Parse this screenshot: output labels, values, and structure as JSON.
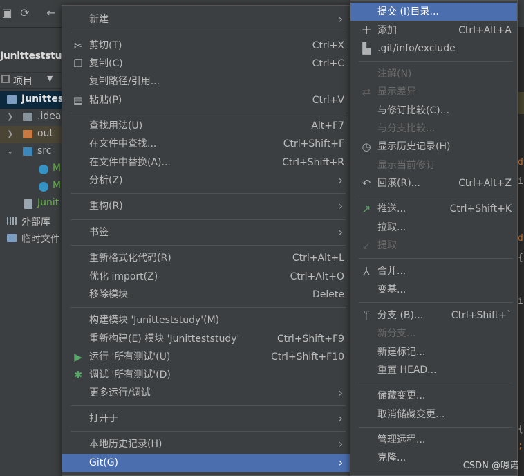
{
  "project_panel": {
    "root_name": "Junitteststudy",
    "view_label": "项目",
    "tree": [
      {
        "label": "Junittes"
      },
      {
        "label": ".idea"
      },
      {
        "label": "out"
      },
      {
        "label": "src"
      },
      {
        "label": "M"
      },
      {
        "label": "M"
      },
      {
        "label": "Junit"
      },
      {
        "label": "外部库"
      },
      {
        "label": "临时文件"
      }
    ]
  },
  "context_menu": {
    "items": [
      {
        "label": "新建",
        "shortcut": "",
        "submenu": true
      },
      {
        "label": "剪切(T)",
        "shortcut": "Ctrl+X",
        "icon": "scissors-icon"
      },
      {
        "label": "复制(C)",
        "shortcut": "Ctrl+C",
        "icon": "copy-icon"
      },
      {
        "label": "复制路径/引用...",
        "shortcut": ""
      },
      {
        "label": "粘贴(P)",
        "shortcut": "Ctrl+V",
        "icon": "paste-icon"
      },
      {
        "label": "查找用法(U)",
        "shortcut": "Alt+F7"
      },
      {
        "label": "在文件中查找...",
        "shortcut": "Ctrl+Shift+F"
      },
      {
        "label": "在文件中替换(A)...",
        "shortcut": "Ctrl+Shift+R"
      },
      {
        "label": "分析(Z)",
        "shortcut": "",
        "submenu": true
      },
      {
        "label": "重构(R)",
        "shortcut": "",
        "submenu": true
      },
      {
        "label": "书签",
        "shortcut": "",
        "submenu": true
      },
      {
        "label": "重新格式化代码(R)",
        "shortcut": "Ctrl+Alt+L"
      },
      {
        "label": "优化 import(Z)",
        "shortcut": "Ctrl+Alt+O"
      },
      {
        "label": "移除模块",
        "shortcut": "Delete"
      },
      {
        "label": "构建模块 'Junitteststudy'(M)",
        "shortcut": ""
      },
      {
        "label": "重新构建(E) 模块 'Junitteststudy'",
        "shortcut": "Ctrl+Shift+F9"
      },
      {
        "label": "运行 '所有测试'(U)",
        "shortcut": "Ctrl+Shift+F10",
        "icon": "run-icon"
      },
      {
        "label": "调试 '所有测试'(D)",
        "shortcut": "",
        "icon": "debug-icon"
      },
      {
        "label": "更多运行/调试",
        "shortcut": "",
        "submenu": true
      },
      {
        "label": "打开于",
        "shortcut": "",
        "submenu": true
      },
      {
        "label": "本地历史记录(H)",
        "shortcut": "",
        "submenu": true
      },
      {
        "label": "Git(G)",
        "shortcut": "",
        "submenu": true,
        "active": true
      }
    ]
  },
  "git_submenu": {
    "items": [
      {
        "label": "提交 (I)目录...",
        "shortcut": "",
        "active": true
      },
      {
        "label": "添加",
        "shortcut": "Ctrl+Alt+A",
        "icon": "plus-icon"
      },
      {
        "label": ".git/info/exclude",
        "shortcut": "",
        "icon": "git-file-icon"
      },
      {
        "label": "注解(N)",
        "shortcut": "",
        "disabled": true
      },
      {
        "label": "显示差异",
        "shortcut": "",
        "disabled": true,
        "icon": "diff-icon"
      },
      {
        "label": "与修订比较(C)...",
        "shortcut": ""
      },
      {
        "label": "与分支比较...",
        "shortcut": "",
        "disabled": true
      },
      {
        "label": "显示历史记录(H)",
        "shortcut": "",
        "icon": "history-icon"
      },
      {
        "label": "显示当前修订",
        "shortcut": "",
        "disabled": true
      },
      {
        "label": "回滚(R)...",
        "shortcut": "Ctrl+Alt+Z",
        "icon": "rollback-icon"
      },
      {
        "label": "推送...",
        "shortcut": "Ctrl+Shift+K",
        "icon": "push-icon"
      },
      {
        "label": "拉取...",
        "shortcut": ""
      },
      {
        "label": "提取",
        "shortcut": "",
        "disabled": true,
        "icon": "fetch-icon"
      },
      {
        "label": "合并...",
        "shortcut": "",
        "icon": "merge-icon"
      },
      {
        "label": "变基...",
        "shortcut": ""
      },
      {
        "label": "分支 (B)...",
        "shortcut": "Ctrl+Shift+`",
        "icon": "branch-icon"
      },
      {
        "label": "新分支...",
        "shortcut": "",
        "disabled": true
      },
      {
        "label": "新建标记...",
        "shortcut": ""
      },
      {
        "label": "重置 HEAD...",
        "shortcut": ""
      },
      {
        "label": "储藏变更...",
        "shortcut": ""
      },
      {
        "label": "取消储藏变更...",
        "shortcut": ""
      },
      {
        "label": "管理远程...",
        "shortcut": ""
      },
      {
        "label": "克隆...",
        "shortcut": ""
      }
    ]
  },
  "watermark": "CSDN @嗯诺",
  "colors": {
    "menu_bg": "#3c3f41",
    "highlight": "#4b6eaf",
    "disabled_text": "#6b6b6b",
    "run_green": "#59a869"
  }
}
